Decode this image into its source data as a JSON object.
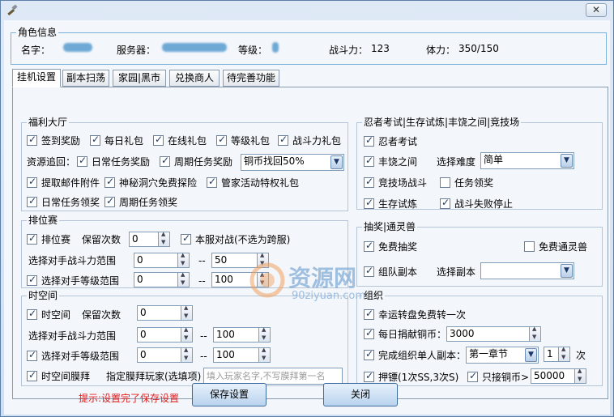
{
  "role_info": {
    "title": "角色信息",
    "name_label": "名字：",
    "server_label": "服务器：",
    "level_label": "等级：",
    "power_label": "战斗力：",
    "power_value": "123",
    "stamina_label": "体力：",
    "stamina_value": "350/150"
  },
  "tabs": [
    "挂机设置",
    "副本扫荡",
    "家园|黑市",
    "兑换商人",
    "待完善功能"
  ],
  "welfare": {
    "title": "福利大厅",
    "row1": [
      "签到奖励",
      "每日礼包",
      "在线礼包",
      "等级礼包",
      "战斗力礼包"
    ],
    "resource_label": "资源追回：",
    "daily_task_reward": "日常任务奖励",
    "period_task_reward": "周期任务奖励",
    "resource_select": "铜币找回50%",
    "row3": [
      "提取邮件附件",
      "神秘洞穴免费探险",
      "管家活动特权礼包"
    ],
    "row4": [
      "日常任务领奖",
      "周期任务领奖"
    ]
  },
  "ranking": {
    "title": "排位赛",
    "enable_label": "排位赛",
    "keep_label": "保留次数",
    "keep_value": "0",
    "local_label": "本服对战(不选为跨服)",
    "power_range_label": "选择对手战斗力范围",
    "power_min": "0",
    "power_max": "50",
    "level_range_label": "选择对手等级范围",
    "level_min": "0",
    "level_max": "100",
    "sep": "--"
  },
  "spacetime": {
    "title": "时空间",
    "enable_label": "时空间",
    "keep_label": "保留次数",
    "keep_value": "0",
    "power_range_label": "选择对手战斗力范围",
    "power_min": "0",
    "power_max": "100",
    "level_range_label": "选择对手等级范围",
    "level_min": "0",
    "level_max": "100",
    "worship_label": "时空间膜拜",
    "worship_target_label": "指定膜拜玩家(选填项)",
    "worship_placeholder": "填入玩家名字,不写膜拜第一名",
    "sep": "--"
  },
  "ninja": {
    "title": "忍者考试|生存试炼|丰饶之间|竞技场",
    "exam": "忍者考试",
    "abundance": "丰饶之间",
    "difficulty_label": "选择难度",
    "difficulty_value": "简单",
    "arena": "竞技场战斗",
    "task_reward": "任务领奖",
    "survival": "生存试炼",
    "stop_on_fail": "战斗失败停止"
  },
  "lottery": {
    "title": "抽奖|通灵兽",
    "free_lottery": "免费抽奖",
    "free_beast": "免费通灵兽",
    "team_dungeon": "组队副本",
    "dungeon_label": "选择副本",
    "dungeon_value": ""
  },
  "guild": {
    "title": "组织",
    "lucky_wheel": "幸运转盘免费转一次",
    "donate_label": "每日捐献铜币：",
    "donate_value": "3000",
    "single_dungeon_label": "完成组织单人副本：",
    "chapter_value": "第一章节",
    "times_value": "1",
    "times_unit": "次",
    "escort_label": "押镖(1次SS,3次S)",
    "coin_only_label": "只接铜币>",
    "coin_value": "50000"
  },
  "footer": {
    "hint": "提示:设置完了保存设置",
    "save": "保存设置",
    "close": "关闭"
  },
  "watermark": {
    "name": "资源网",
    "url": "90ziyuan.com"
  }
}
